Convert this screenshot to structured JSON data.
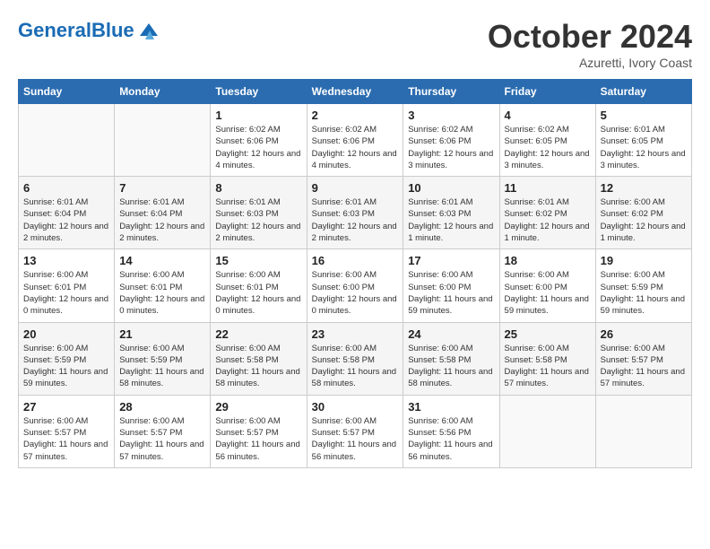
{
  "logo": {
    "text_general": "General",
    "text_blue": "Blue"
  },
  "title": "October 2024",
  "subtitle": "Azuretti, Ivory Coast",
  "days_header": [
    "Sunday",
    "Monday",
    "Tuesday",
    "Wednesday",
    "Thursday",
    "Friday",
    "Saturday"
  ],
  "weeks": [
    [
      {
        "num": "",
        "detail": ""
      },
      {
        "num": "",
        "detail": ""
      },
      {
        "num": "1",
        "detail": "Sunrise: 6:02 AM\nSunset: 6:06 PM\nDaylight: 12 hours and 4 minutes."
      },
      {
        "num": "2",
        "detail": "Sunrise: 6:02 AM\nSunset: 6:06 PM\nDaylight: 12 hours and 4 minutes."
      },
      {
        "num": "3",
        "detail": "Sunrise: 6:02 AM\nSunset: 6:06 PM\nDaylight: 12 hours and 3 minutes."
      },
      {
        "num": "4",
        "detail": "Sunrise: 6:02 AM\nSunset: 6:05 PM\nDaylight: 12 hours and 3 minutes."
      },
      {
        "num": "5",
        "detail": "Sunrise: 6:01 AM\nSunset: 6:05 PM\nDaylight: 12 hours and 3 minutes."
      }
    ],
    [
      {
        "num": "6",
        "detail": "Sunrise: 6:01 AM\nSunset: 6:04 PM\nDaylight: 12 hours and 2 minutes."
      },
      {
        "num": "7",
        "detail": "Sunrise: 6:01 AM\nSunset: 6:04 PM\nDaylight: 12 hours and 2 minutes."
      },
      {
        "num": "8",
        "detail": "Sunrise: 6:01 AM\nSunset: 6:03 PM\nDaylight: 12 hours and 2 minutes."
      },
      {
        "num": "9",
        "detail": "Sunrise: 6:01 AM\nSunset: 6:03 PM\nDaylight: 12 hours and 2 minutes."
      },
      {
        "num": "10",
        "detail": "Sunrise: 6:01 AM\nSunset: 6:03 PM\nDaylight: 12 hours and 1 minute."
      },
      {
        "num": "11",
        "detail": "Sunrise: 6:01 AM\nSunset: 6:02 PM\nDaylight: 12 hours and 1 minute."
      },
      {
        "num": "12",
        "detail": "Sunrise: 6:00 AM\nSunset: 6:02 PM\nDaylight: 12 hours and 1 minute."
      }
    ],
    [
      {
        "num": "13",
        "detail": "Sunrise: 6:00 AM\nSunset: 6:01 PM\nDaylight: 12 hours and 0 minutes."
      },
      {
        "num": "14",
        "detail": "Sunrise: 6:00 AM\nSunset: 6:01 PM\nDaylight: 12 hours and 0 minutes."
      },
      {
        "num": "15",
        "detail": "Sunrise: 6:00 AM\nSunset: 6:01 PM\nDaylight: 12 hours and 0 minutes."
      },
      {
        "num": "16",
        "detail": "Sunrise: 6:00 AM\nSunset: 6:00 PM\nDaylight: 12 hours and 0 minutes."
      },
      {
        "num": "17",
        "detail": "Sunrise: 6:00 AM\nSunset: 6:00 PM\nDaylight: 11 hours and 59 minutes."
      },
      {
        "num": "18",
        "detail": "Sunrise: 6:00 AM\nSunset: 6:00 PM\nDaylight: 11 hours and 59 minutes."
      },
      {
        "num": "19",
        "detail": "Sunrise: 6:00 AM\nSunset: 5:59 PM\nDaylight: 11 hours and 59 minutes."
      }
    ],
    [
      {
        "num": "20",
        "detail": "Sunrise: 6:00 AM\nSunset: 5:59 PM\nDaylight: 11 hours and 59 minutes."
      },
      {
        "num": "21",
        "detail": "Sunrise: 6:00 AM\nSunset: 5:59 PM\nDaylight: 11 hours and 58 minutes."
      },
      {
        "num": "22",
        "detail": "Sunrise: 6:00 AM\nSunset: 5:58 PM\nDaylight: 11 hours and 58 minutes."
      },
      {
        "num": "23",
        "detail": "Sunrise: 6:00 AM\nSunset: 5:58 PM\nDaylight: 11 hours and 58 minutes."
      },
      {
        "num": "24",
        "detail": "Sunrise: 6:00 AM\nSunset: 5:58 PM\nDaylight: 11 hours and 58 minutes."
      },
      {
        "num": "25",
        "detail": "Sunrise: 6:00 AM\nSunset: 5:58 PM\nDaylight: 11 hours and 57 minutes."
      },
      {
        "num": "26",
        "detail": "Sunrise: 6:00 AM\nSunset: 5:57 PM\nDaylight: 11 hours and 57 minutes."
      }
    ],
    [
      {
        "num": "27",
        "detail": "Sunrise: 6:00 AM\nSunset: 5:57 PM\nDaylight: 11 hours and 57 minutes."
      },
      {
        "num": "28",
        "detail": "Sunrise: 6:00 AM\nSunset: 5:57 PM\nDaylight: 11 hours and 57 minutes."
      },
      {
        "num": "29",
        "detail": "Sunrise: 6:00 AM\nSunset: 5:57 PM\nDaylight: 11 hours and 56 minutes."
      },
      {
        "num": "30",
        "detail": "Sunrise: 6:00 AM\nSunset: 5:57 PM\nDaylight: 11 hours and 56 minutes."
      },
      {
        "num": "31",
        "detail": "Sunrise: 6:00 AM\nSunset: 5:56 PM\nDaylight: 11 hours and 56 minutes."
      },
      {
        "num": "",
        "detail": ""
      },
      {
        "num": "",
        "detail": ""
      }
    ]
  ]
}
